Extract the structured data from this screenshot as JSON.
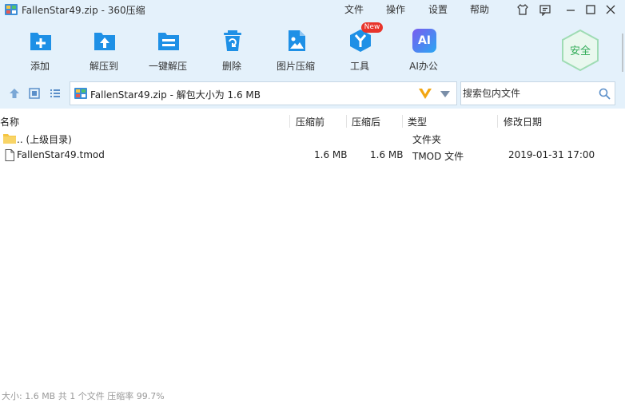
{
  "window": {
    "title": "FallenStar49.zip - 360压缩",
    "menu": [
      "文件",
      "操作",
      "设置",
      "帮助"
    ]
  },
  "toolbar": {
    "items": [
      {
        "label": "添加",
        "icon": "add-icon"
      },
      {
        "label": "解压到",
        "icon": "extract-to-icon"
      },
      {
        "label": "一键解压",
        "icon": "one-click-extract-icon"
      },
      {
        "label": "删除",
        "icon": "delete-icon"
      },
      {
        "label": "图片压缩",
        "icon": "image-compress-icon"
      },
      {
        "label": "工具",
        "icon": "tools-icon",
        "badge": "New"
      },
      {
        "label": "AI办公",
        "icon": "ai-office-icon",
        "icon_text": "AI"
      }
    ],
    "security": "安全"
  },
  "address": {
    "path": "FallenStar49.zip - 解包大小为 1.6 MB"
  },
  "search": {
    "placeholder": "搜索包内文件"
  },
  "columns": [
    "名称",
    "压缩前",
    "压缩后",
    "类型",
    "修改日期"
  ],
  "rows": [
    {
      "name": ".. (上级目录)",
      "before": "",
      "after": "",
      "type": "文件夹",
      "date": "",
      "icon": "folder-icon"
    },
    {
      "name": "FallenStar49.tmod",
      "before": "1.6 MB",
      "after": "1.6 MB",
      "type": "TMOD 文件",
      "date": "2019-01-31 17:00",
      "icon": "file-icon"
    }
  ],
  "status": "大小: 1.6 MB 共 1 个文件 压缩率 99.7%",
  "colors": {
    "toolbar_bg": "#e4f1fb",
    "accent_blue": "#1e90e6",
    "security_green": "#2eaa55",
    "badge_red": "#e8342b"
  }
}
